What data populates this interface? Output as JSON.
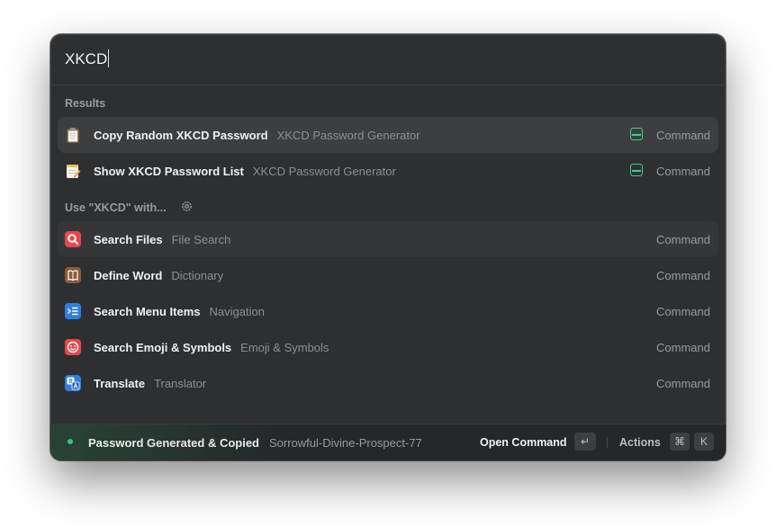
{
  "search": {
    "query": "XKCD"
  },
  "sections": {
    "results_title": "Results",
    "fallback_title": "Use \"XKCD\" with..."
  },
  "results": [
    {
      "title": "Copy Random XKCD Password",
      "subtitle": "XKCD Password Generator",
      "type": "Command",
      "icon": "clipboard-icon",
      "accessory": "store-icon"
    },
    {
      "title": "Show XKCD Password List",
      "subtitle": "XKCD Password Generator",
      "type": "Command",
      "icon": "notepad-icon",
      "accessory": "store-icon"
    }
  ],
  "fallbacks": [
    {
      "title": "Search Files",
      "subtitle": "File Search",
      "type": "Command",
      "icon": "magnifier-icon",
      "color": "#e5484d"
    },
    {
      "title": "Define Word",
      "subtitle": "Dictionary",
      "type": "Command",
      "icon": "book-icon",
      "color": "#8a5a3c"
    },
    {
      "title": "Search Menu Items",
      "subtitle": "Navigation",
      "type": "Command",
      "icon": "menu-list-icon",
      "color": "#2f7fe0"
    },
    {
      "title": "Search Emoji & Symbols",
      "subtitle": "Emoji & Symbols",
      "type": "Command",
      "icon": "smiley-icon",
      "color": "#e5484d"
    },
    {
      "title": "Translate",
      "subtitle": "Translator",
      "type": "Command",
      "icon": "translate-icon",
      "color": "#2f7fe0"
    }
  ],
  "footer": {
    "toast_title": "Password Generated & Copied",
    "toast_message": "Sorrowful-Divine-Prospect-77",
    "primary_action": "Open Command",
    "primary_key": "↵",
    "actions_label": "Actions",
    "actions_keys": [
      "⌘",
      "K"
    ]
  },
  "colors": {
    "accent_green": "#3fcf8e",
    "selection": "#3d3e41"
  }
}
